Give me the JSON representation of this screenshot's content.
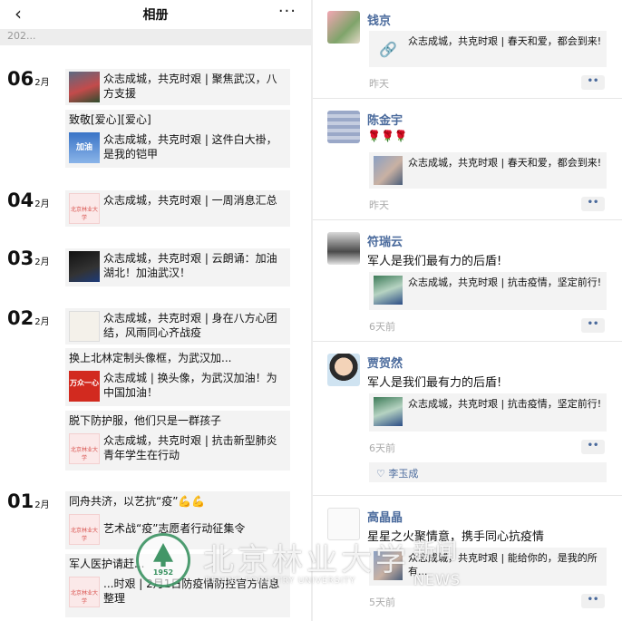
{
  "album": {
    "title": "相册",
    "back_icon": "‹",
    "more_icon": "···",
    "year": "202...",
    "days": [
      {
        "day": "06",
        "month": "2月",
        "posts": [
          {
            "text": "众志成城，共克时艰 | 聚焦武汉，八方支援",
            "thumb": "crowd-photo"
          },
          {
            "caption": "致敬[爱心][爱心]",
            "text": "众志成城，共克时艰 | 这件白大褂，是我的铠甲",
            "thumb": "jiayou-blue"
          }
        ]
      },
      {
        "day": "04",
        "month": "2月",
        "posts": [
          {
            "text": "众志成城，共克时艰 | 一周消息汇总",
            "thumb": "pink-logo"
          }
        ]
      },
      {
        "day": "03",
        "month": "2月",
        "posts": [
          {
            "text": "众志成城，共克时艰 | 云朗诵：加油湖北！加油武汉！",
            "thumb": "dark-poster"
          }
        ]
      },
      {
        "day": "02",
        "month": "2月",
        "posts": [
          {
            "text": "众志成城，共克时艰 | 身在八方心团结，风雨同心齐战疫",
            "thumb": "sketch"
          },
          {
            "caption": "换上北林定制头像框，为武汉加...",
            "text": "众志成城 | 换头像，为武汉加油！为中国加油！",
            "thumb": "wanzhong-yixin"
          },
          {
            "caption": "脱下防护服，他们只是一群孩子",
            "text": "众志成城，共克时艰 | 抗击新型肺炎青年学生在行动",
            "thumb": "pink-logo"
          }
        ]
      },
      {
        "day": "01",
        "month": "2月",
        "posts": [
          {
            "caption": "同舟共济，以艺抗“疫”💪💪",
            "text": "艺术战“疫”志愿者行动征集令",
            "thumb": "pink-logo"
          },
          {
            "caption": "军人医护请赶...",
            "text_a": "物资汇...",
            "text": "...时艰 | 2月1日防疫情防控官方信息整理",
            "thumb": "pink-logo"
          }
        ]
      }
    ],
    "thumb_labels": {
      "jiayou": "加油",
      "wanzhong": "万众一心",
      "pink": "北京林业大学"
    }
  },
  "comments": [
    {
      "name": "钱京",
      "text": "",
      "share": "众志成城，共克时艰 | 春天和爱，都会到来!",
      "share_thumb": "link-icon",
      "time": "昨天",
      "avatar": "flower"
    },
    {
      "name": "陈金宇",
      "text": "🌹🌹🌹",
      "share": "众志成城，共克时艰 | 春天和爱，都会到来!",
      "share_thumb": "couple",
      "time": "昨天",
      "avatar": "stripes"
    },
    {
      "name": "符瑞云",
      "text": "军人是我们最有力的后盾!",
      "share": "众志成城，共克时艰 | 抗击疫情，坚定前行!",
      "share_thumb": "green",
      "time": "6天前",
      "avatar": "girl"
    },
    {
      "name": "贾贺然",
      "text": "军人是我们最有力的后盾!",
      "share": "众志成城，共克时艰 | 抗击疫情，坚定前行!",
      "share_thumb": "green",
      "time": "6天前",
      "avatar": "child",
      "likes": "李玉成"
    },
    {
      "name": "高晶晶",
      "text": "星星之火聚情意，携手同心抗疫情",
      "share": "众志成城，共克时艰 | 能给你的，是我的所有...",
      "share_thumb": "couple",
      "time": "5天前",
      "avatar": "doc"
    }
  ],
  "ui": {
    "dots": "••",
    "heart_icon": "♡",
    "link_icon": "🔗"
  },
  "watermark": {
    "name": "北京林业大学",
    "english": "BEIJING FORESTRY UNIVERSITY",
    "news_cn": "新闻",
    "news_en": "NEWS",
    "year": "1952"
  }
}
